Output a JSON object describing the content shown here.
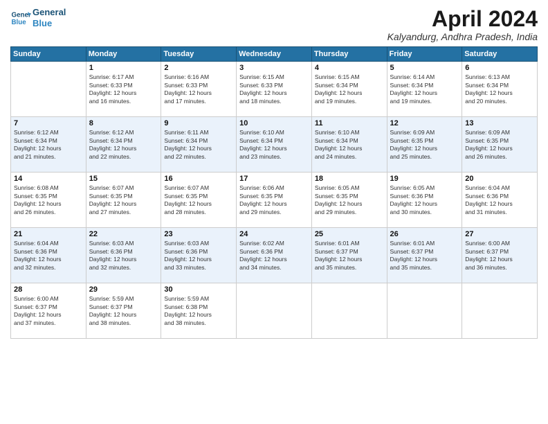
{
  "logo": {
    "line1": "General",
    "line2": "Blue"
  },
  "title": "April 2024",
  "subtitle": "Kalyandurg, Andhra Pradesh, India",
  "days_header": [
    "Sunday",
    "Monday",
    "Tuesday",
    "Wednesday",
    "Thursday",
    "Friday",
    "Saturday"
  ],
  "weeks": [
    [
      {
        "day": "",
        "info": ""
      },
      {
        "day": "1",
        "info": "Sunrise: 6:17 AM\nSunset: 6:33 PM\nDaylight: 12 hours\nand 16 minutes."
      },
      {
        "day": "2",
        "info": "Sunrise: 6:16 AM\nSunset: 6:33 PM\nDaylight: 12 hours\nand 17 minutes."
      },
      {
        "day": "3",
        "info": "Sunrise: 6:15 AM\nSunset: 6:33 PM\nDaylight: 12 hours\nand 18 minutes."
      },
      {
        "day": "4",
        "info": "Sunrise: 6:15 AM\nSunset: 6:34 PM\nDaylight: 12 hours\nand 19 minutes."
      },
      {
        "day": "5",
        "info": "Sunrise: 6:14 AM\nSunset: 6:34 PM\nDaylight: 12 hours\nand 19 minutes."
      },
      {
        "day": "6",
        "info": "Sunrise: 6:13 AM\nSunset: 6:34 PM\nDaylight: 12 hours\nand 20 minutes."
      }
    ],
    [
      {
        "day": "7",
        "info": "Sunrise: 6:12 AM\nSunset: 6:34 PM\nDaylight: 12 hours\nand 21 minutes."
      },
      {
        "day": "8",
        "info": "Sunrise: 6:12 AM\nSunset: 6:34 PM\nDaylight: 12 hours\nand 22 minutes."
      },
      {
        "day": "9",
        "info": "Sunrise: 6:11 AM\nSunset: 6:34 PM\nDaylight: 12 hours\nand 22 minutes."
      },
      {
        "day": "10",
        "info": "Sunrise: 6:10 AM\nSunset: 6:34 PM\nDaylight: 12 hours\nand 23 minutes."
      },
      {
        "day": "11",
        "info": "Sunrise: 6:10 AM\nSunset: 6:34 PM\nDaylight: 12 hours\nand 24 minutes."
      },
      {
        "day": "12",
        "info": "Sunrise: 6:09 AM\nSunset: 6:35 PM\nDaylight: 12 hours\nand 25 minutes."
      },
      {
        "day": "13",
        "info": "Sunrise: 6:09 AM\nSunset: 6:35 PM\nDaylight: 12 hours\nand 26 minutes."
      }
    ],
    [
      {
        "day": "14",
        "info": "Sunrise: 6:08 AM\nSunset: 6:35 PM\nDaylight: 12 hours\nand 26 minutes."
      },
      {
        "day": "15",
        "info": "Sunrise: 6:07 AM\nSunset: 6:35 PM\nDaylight: 12 hours\nand 27 minutes."
      },
      {
        "day": "16",
        "info": "Sunrise: 6:07 AM\nSunset: 6:35 PM\nDaylight: 12 hours\nand 28 minutes."
      },
      {
        "day": "17",
        "info": "Sunrise: 6:06 AM\nSunset: 6:35 PM\nDaylight: 12 hours\nand 29 minutes."
      },
      {
        "day": "18",
        "info": "Sunrise: 6:05 AM\nSunset: 6:35 PM\nDaylight: 12 hours\nand 29 minutes."
      },
      {
        "day": "19",
        "info": "Sunrise: 6:05 AM\nSunset: 6:36 PM\nDaylight: 12 hours\nand 30 minutes."
      },
      {
        "day": "20",
        "info": "Sunrise: 6:04 AM\nSunset: 6:36 PM\nDaylight: 12 hours\nand 31 minutes."
      }
    ],
    [
      {
        "day": "21",
        "info": "Sunrise: 6:04 AM\nSunset: 6:36 PM\nDaylight: 12 hours\nand 32 minutes."
      },
      {
        "day": "22",
        "info": "Sunrise: 6:03 AM\nSunset: 6:36 PM\nDaylight: 12 hours\nand 32 minutes."
      },
      {
        "day": "23",
        "info": "Sunrise: 6:03 AM\nSunset: 6:36 PM\nDaylight: 12 hours\nand 33 minutes."
      },
      {
        "day": "24",
        "info": "Sunrise: 6:02 AM\nSunset: 6:36 PM\nDaylight: 12 hours\nand 34 minutes."
      },
      {
        "day": "25",
        "info": "Sunrise: 6:01 AM\nSunset: 6:37 PM\nDaylight: 12 hours\nand 35 minutes."
      },
      {
        "day": "26",
        "info": "Sunrise: 6:01 AM\nSunset: 6:37 PM\nDaylight: 12 hours\nand 35 minutes."
      },
      {
        "day": "27",
        "info": "Sunrise: 6:00 AM\nSunset: 6:37 PM\nDaylight: 12 hours\nand 36 minutes."
      }
    ],
    [
      {
        "day": "28",
        "info": "Sunrise: 6:00 AM\nSunset: 6:37 PM\nDaylight: 12 hours\nand 37 minutes."
      },
      {
        "day": "29",
        "info": "Sunrise: 5:59 AM\nSunset: 6:37 PM\nDaylight: 12 hours\nand 38 minutes."
      },
      {
        "day": "30",
        "info": "Sunrise: 5:59 AM\nSunset: 6:38 PM\nDaylight: 12 hours\nand 38 minutes."
      },
      {
        "day": "",
        "info": ""
      },
      {
        "day": "",
        "info": ""
      },
      {
        "day": "",
        "info": ""
      },
      {
        "day": "",
        "info": ""
      }
    ]
  ]
}
